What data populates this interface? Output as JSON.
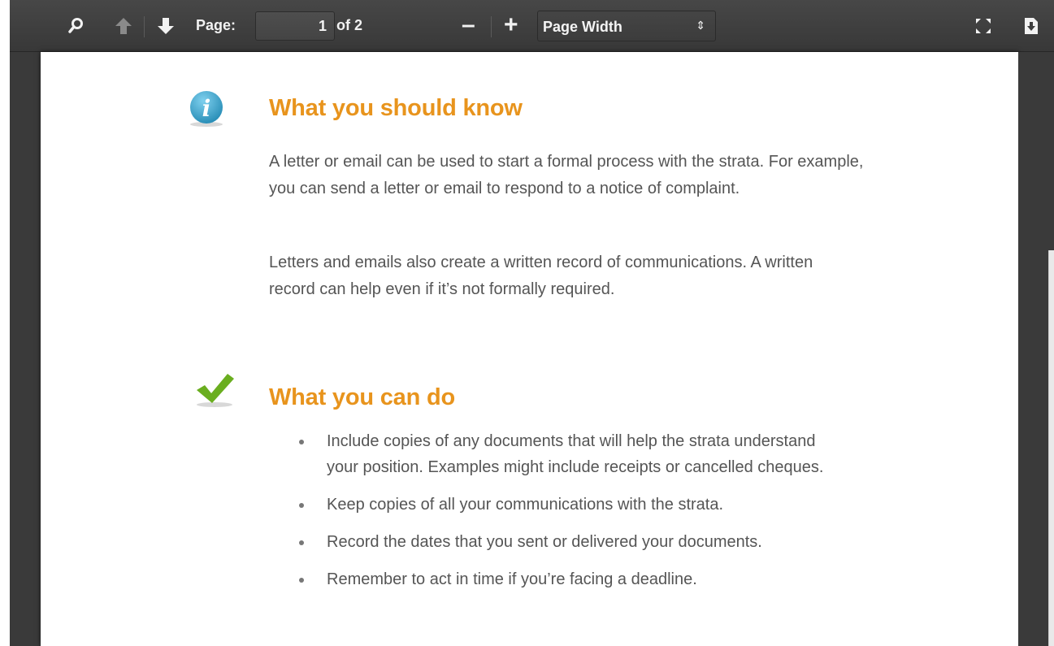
{
  "toolbar": {
    "page_label": "Page:",
    "page_value": "1",
    "page_total": "of 2",
    "zoom_out": "–",
    "zoom_in": "+",
    "zoom_selected": "Page Width",
    "select_arrows": "⇕",
    "icons": [
      "search-icon",
      "previous-page-icon",
      "next-page-icon",
      "fullscreen-icon",
      "download-icon"
    ]
  },
  "document": {
    "section1": {
      "heading": "What you should know",
      "icon": "info-icon",
      "icon_color": "#3aa3c9",
      "paragraphs": [
        "A letter or email can be used to start a formal process with the strata. For example, you can send a letter or email to respond to a notice of complaint.",
        "Letters and emails also create a written record of communications. A written record can help even if it’s not formally required."
      ]
    },
    "section2": {
      "heading": "What you can do",
      "icon": "checkmark-icon",
      "icon_color": "#6aae1f",
      "bullets": [
        "Include copies of any documents that will help the strata understand your position. Examples might include receipts or cancelled cheques.",
        "Keep copies of all your communications with the strata.",
        "Record the dates that you sent or delivered your documents.",
        "Remember to act in time if you’re facing a deadline."
      ]
    },
    "heading_color": "#e8941d"
  }
}
